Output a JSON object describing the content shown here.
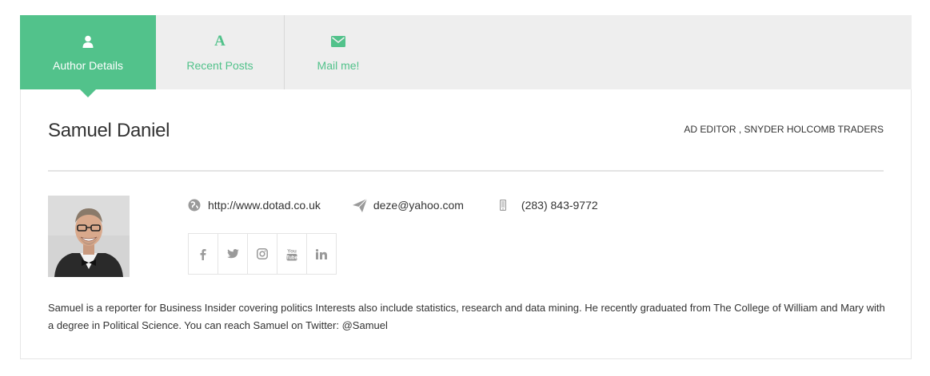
{
  "tabs": [
    {
      "label": "Author Details",
      "icon": "user-icon",
      "active": true
    },
    {
      "label": "Recent Posts",
      "icon": "letter-a-icon",
      "active": false
    },
    {
      "label": "Mail me!",
      "icon": "envelope-icon",
      "active": false
    }
  ],
  "author": {
    "name": "Samuel Daniel",
    "role": "AD EDITOR , SNYDER HOLCOMB TRADERS",
    "website": "http://www.dotad.co.uk",
    "email": "deze@yahoo.com",
    "phone": "(283) 843-9772",
    "bio": "Samuel is a reporter for Business Insider covering politics Interests also include statistics, research and data mining. He recently graduated from The College of William and Mary with a degree in Political Science. You can reach Samuel on Twitter: @Samuel"
  },
  "social": [
    "facebook-icon",
    "twitter-icon",
    "instagram-icon",
    "youtube-icon",
    "linkedin-icon"
  ],
  "colors": {
    "accent": "#52c28b",
    "tabbar": "#eeeeee",
    "icon_gray": "#9a9a9a"
  }
}
